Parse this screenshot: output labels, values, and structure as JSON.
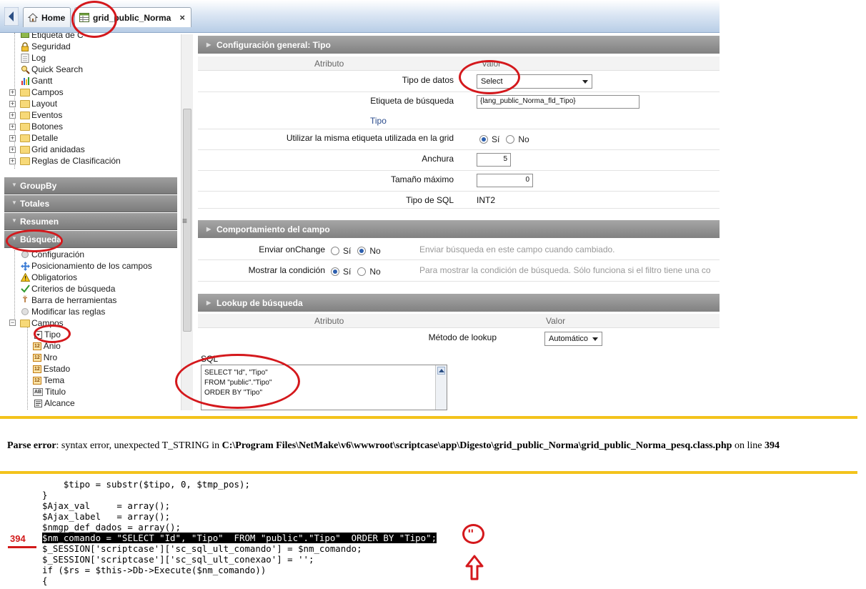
{
  "tabs": {
    "home_label": "Home",
    "grid_label": "grid_public_Norma",
    "close_glyph": "×"
  },
  "tree": {
    "top_items": [
      {
        "label": "Etiqueta de C",
        "icon": "label-icon"
      },
      {
        "label": "Seguridad",
        "icon": "lock-icon"
      },
      {
        "label": "Log",
        "icon": "log-icon"
      },
      {
        "label": "Quick Search",
        "icon": "quick-search-icon"
      },
      {
        "label": "Gantt",
        "icon": "gantt-chart-icon"
      }
    ],
    "folders": [
      "Campos",
      "Layout",
      "Eventos",
      "Botones",
      "Detalle",
      "Grid anidadas",
      "Reglas de Clasificación"
    ],
    "sections": [
      "GroupBy",
      "Totales",
      "Resumen",
      "Búsqueda"
    ],
    "busqueda_items": [
      {
        "label": "Configuración",
        "icon": "config-icon"
      },
      {
        "label": "Posicionamiento de los campos",
        "icon": "move-arrows-icon"
      },
      {
        "label": "Obligatorios",
        "icon": "warning-icon"
      },
      {
        "label": "Criterios de búsqueda",
        "icon": "checkmark-icon"
      },
      {
        "label": "Barra de herramientas",
        "icon": "toolbar-icon"
      },
      {
        "label": "Modificar las reglas",
        "icon": "rules-icon"
      }
    ],
    "campos_folder": "Campos",
    "campos_fields": [
      {
        "label": "Tipo",
        "badge": "",
        "selected": true
      },
      {
        "label": "Anio",
        "badge": "12"
      },
      {
        "label": "Nro",
        "badge": "12"
      },
      {
        "label": "Estado",
        "badge": "12"
      },
      {
        "label": "Tema",
        "badge": "12"
      },
      {
        "label": "Titulo",
        "badge": "AB"
      },
      {
        "label": "Alcance",
        "badge": ""
      }
    ],
    "splitter_glyph": "≡"
  },
  "config": {
    "title": "Configuración general: Tipo",
    "col_attr": "Atributo",
    "col_val": "Valor",
    "tipo_datos_label": "Tipo de datos",
    "tipo_datos_value": "Select",
    "etiqueta_label": "Etiqueta de búsqueda",
    "etiqueta_value": "{lang_public_Norma_fld_Tipo}",
    "etiqueta_preview": "Tipo",
    "misma_label": "Utilizar la misma etiqueta utilizada en la grid",
    "si": "Sí",
    "no": "No",
    "anchura_label": "Anchura",
    "anchura_value": "5",
    "tamano_label": "Tamaño máximo",
    "tamano_value": "0",
    "tipo_sql_label": "Tipo de SQL",
    "tipo_sql_value": "INT2"
  },
  "behavior": {
    "title": "Comportamiento del campo",
    "onchange_label": "Enviar onChange",
    "onchange_hint": "Enviar búsqueda en este campo cuando cambiado.",
    "condicion_label": "Mostrar la condición",
    "condicion_hint": "Para mostrar la condición de búsqueda. Sólo funciona si el filtro tiene una co",
    "si": "Sí",
    "no": "No"
  },
  "lookup": {
    "title": "Lookup de búsqueda",
    "col_attr": "Atributo",
    "col_val": "Valor",
    "metodo_label": "Método de lookup",
    "metodo_value": "Automático",
    "sql_label": "SQL",
    "sql_text": "SELECT \"Id\", \"Tipo\"\nFROM \"public\".\"Tipo\"\nORDER BY \"Tipo\""
  },
  "error": {
    "prefix": "Parse error",
    "message": ": syntax error, unexpected T_STRING in ",
    "path": "C:\\Program Files\\NetMake\\v6\\wwwroot\\scriptcase\\app\\Digesto\\grid_public_Norma\\grid_public_Norma_pesq.class.php",
    "on_line": " on line ",
    "line": "394"
  },
  "code": {
    "lines": [
      "    $tipo = substr($tipo, 0, $tmp_pos);",
      "}",
      "$Ajax_val     = array();",
      "$Ajax_label   = array();",
      "$nmgp_def_dados = array();",
      "$nm_comando = \"SELECT \"Id\", \"Tipo\"  FROM \"public\".\"Tipo\"  ORDER BY \"Tipo\";",
      "$_SESSION['scriptcase']['sc_sql_ult_comando'] = $nm_comando;",
      "$_SESSION['scriptcase']['sc_sql_ult_conexao'] = '';",
      "if ($rs = $this->Db->Execute($nm_comando))",
      "{"
    ],
    "highlight_index": 5,
    "line_number": "394",
    "annotation_quote": "\"",
    "accent": "#d4181c"
  }
}
